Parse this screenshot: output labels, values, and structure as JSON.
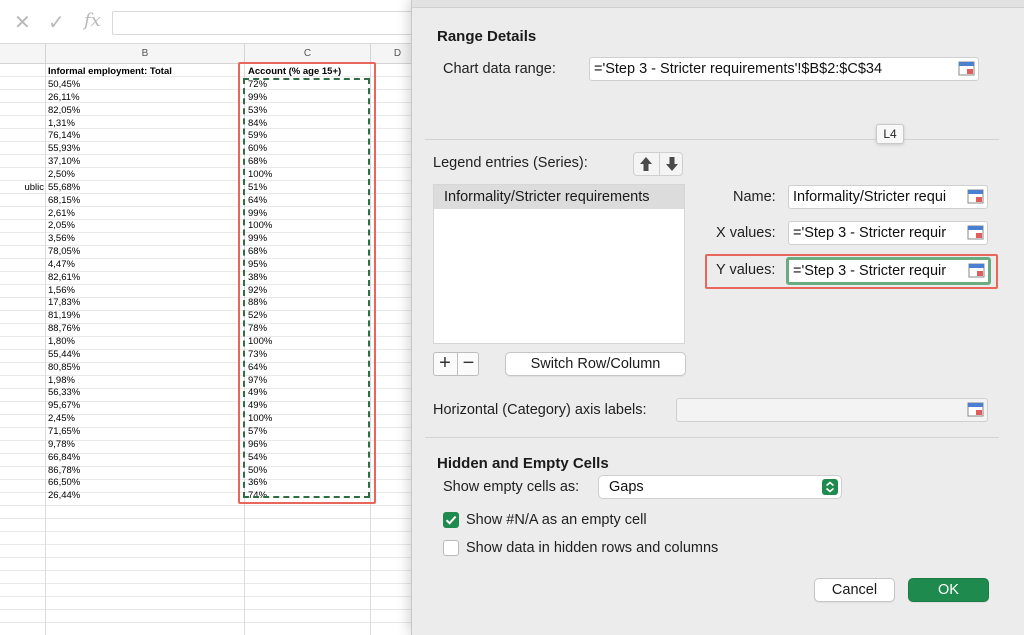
{
  "sheet": {
    "columns": [
      "B",
      "C",
      "D"
    ],
    "header_b": "Informal employment: Total",
    "header_c": "Account (% age 15+)",
    "partial_label": "ublic",
    "rows": [
      [
        "50,45%",
        "72%"
      ],
      [
        "26,11%",
        "99%"
      ],
      [
        "82,05%",
        "53%"
      ],
      [
        "1,31%",
        "84%"
      ],
      [
        "76,14%",
        "59%"
      ],
      [
        "55,93%",
        "60%"
      ],
      [
        "37,10%",
        "68%"
      ],
      [
        "2,50%",
        "100%"
      ],
      [
        "55,68%",
        "51%"
      ],
      [
        "68,15%",
        "64%"
      ],
      [
        "2,61%",
        "99%"
      ],
      [
        "2,05%",
        "100%"
      ],
      [
        "3,56%",
        "99%"
      ],
      [
        "78,05%",
        "68%"
      ],
      [
        "4,47%",
        "95%"
      ],
      [
        "82,61%",
        "38%"
      ],
      [
        "1,56%",
        "92%"
      ],
      [
        "17,83%",
        "88%"
      ],
      [
        "81,19%",
        "52%"
      ],
      [
        "88,76%",
        "78%"
      ],
      [
        "1,80%",
        "100%"
      ],
      [
        "55,44%",
        "73%"
      ],
      [
        "80,85%",
        "64%"
      ],
      [
        "1,98%",
        "97%"
      ],
      [
        "56,33%",
        "49%"
      ],
      [
        "95,67%",
        "49%"
      ],
      [
        "2,45%",
        "100%"
      ],
      [
        "71,65%",
        "57%"
      ],
      [
        "9,78%",
        "96%"
      ],
      [
        "66,84%",
        "54%"
      ],
      [
        "86,78%",
        "50%"
      ],
      [
        "66,50%",
        "36%"
      ],
      [
        "26,44%",
        "74%"
      ]
    ]
  },
  "dialog": {
    "range_details_title": "Range Details",
    "chart_data_range_label": "Chart data range:",
    "chart_data_range_value": "='Step 3 - Stricter requirements'!$B$2:$C$34",
    "tooltip": "L4",
    "legend_label": "Legend entries (Series):",
    "series": [
      "Informality/Stricter requirements"
    ],
    "name_label": "Name:",
    "name_value": "Informality/Stricter requi",
    "x_values_label": "X values:",
    "x_values_value": "='Step 3 - Stricter requir",
    "y_values_label": "Y values:",
    "y_values_value": "='Step 3 - Stricter requir",
    "plus": "+",
    "minus": "−",
    "switch_button": "Switch Row/Column",
    "horizontal_axis_label": "Horizontal (Category) axis labels:",
    "horizontal_axis_value": "",
    "hidden_empty_title": "Hidden and Empty Cells",
    "show_empty_label": "Show empty cells as:",
    "show_empty_value": "Gaps",
    "na_checkbox_label": "Show #N/A as an empty cell",
    "na_checked": true,
    "hidden_rows_label": "Show data in hidden rows and columns",
    "hidden_rows_checked": false,
    "cancel": "Cancel",
    "ok": "OK",
    "accent_color": "#1f8a4d",
    "highlight_color": "#e8665a"
  }
}
